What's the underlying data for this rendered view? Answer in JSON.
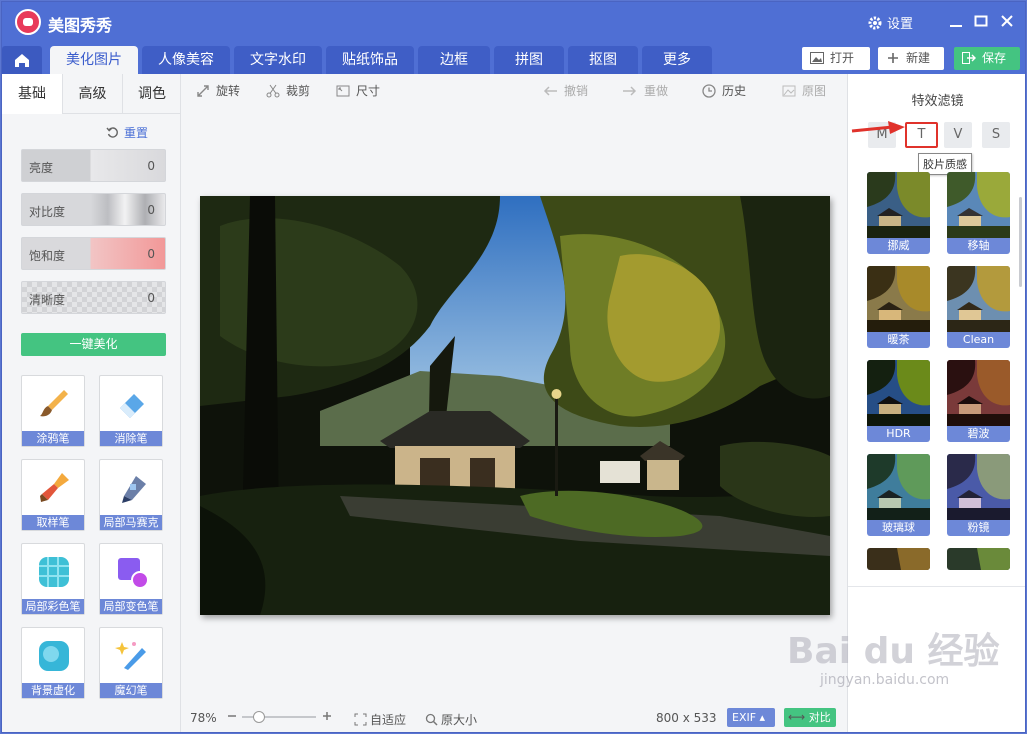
{
  "app": {
    "title": "美图秀秀",
    "settings": "设置"
  },
  "tabs": [
    "美化图片",
    "人像美容",
    "文字水印",
    "贴纸饰品",
    "边框",
    "拼图",
    "抠图",
    "更多"
  ],
  "top_buttons": {
    "open": "打开",
    "new": "新建",
    "save": "保存"
  },
  "left_panel": {
    "subtabs": [
      "基础",
      "高级",
      "调色"
    ],
    "reset": "重置",
    "sliders": [
      {
        "label": "亮度",
        "value": "0"
      },
      {
        "label": "对比度",
        "value": "0"
      },
      {
        "label": "饱和度",
        "value": "0"
      },
      {
        "label": "清晰度",
        "value": "0"
      }
    ],
    "one_key": "一键美化",
    "tools": [
      "涂鸦笔",
      "消除笔",
      "取样笔",
      "局部马赛克",
      "局部彩色笔",
      "局部变色笔",
      "背景虚化",
      "魔幻笔"
    ]
  },
  "edit_toolbar": {
    "rotate": "旋转",
    "crop": "裁剪",
    "size": "尺寸",
    "undo": "撤销",
    "redo": "重做",
    "history": "历史",
    "original": "原图"
  },
  "bottom_bar": {
    "zoom": "78%",
    "fit": "自适应",
    "actual": "原大小",
    "dimensions": "800 x 533",
    "exif": "EXIF",
    "compare": "对比"
  },
  "right_panel": {
    "title": "特效滤镜",
    "categories": [
      "M",
      "T",
      "V",
      "S"
    ],
    "selected_category": "T",
    "tooltip": "胶片质感",
    "filters": [
      "挪威",
      "移轴",
      "暖茶",
      "Clean",
      "HDR",
      "碧波",
      "玻璃球",
      "粉镜"
    ]
  },
  "watermark": {
    "text": "Bai du 经验",
    "url": "jingyan.baidu.com"
  },
  "colors": {
    "accent": "#4f6fd4",
    "green": "#44c481",
    "label_bar": "#6d88d8",
    "highlight": "#e0322b"
  }
}
